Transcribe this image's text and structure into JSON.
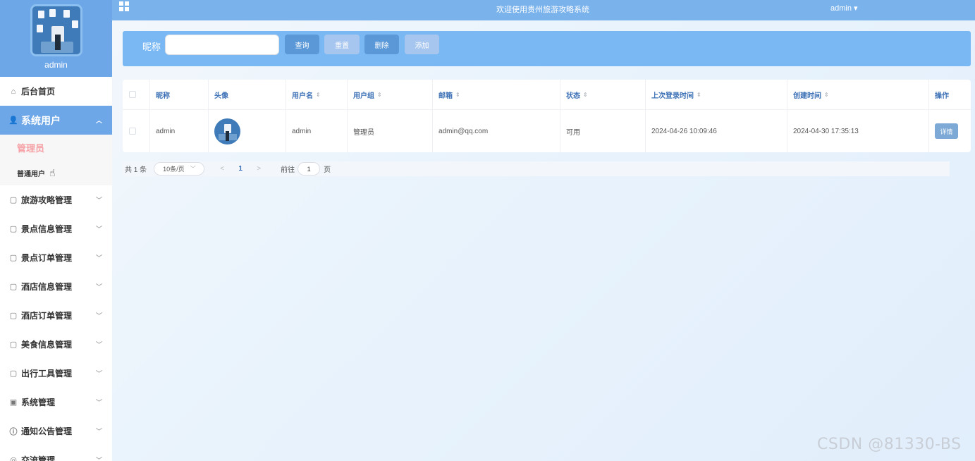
{
  "app": {
    "welcome_title": "欢迎使用贵州旅游攻略系统",
    "user_menu": "admin ▾"
  },
  "sidebar": {
    "username": "admin",
    "items": [
      {
        "label": "后台首页",
        "icon": "home-icon"
      },
      {
        "label": "系统用户",
        "icon": "user-icon",
        "active": true
      },
      {
        "label": "旅游攻略管理",
        "icon": "folder-icon"
      },
      {
        "label": "景点信息管理",
        "icon": "folder-icon"
      },
      {
        "label": "景点订单管理",
        "icon": "folder-icon"
      },
      {
        "label": "酒店信息管理",
        "icon": "folder-icon"
      },
      {
        "label": "酒店订单管理",
        "icon": "folder-icon"
      },
      {
        "label": "美食信息管理",
        "icon": "folder-icon"
      },
      {
        "label": "出行工具管理",
        "icon": "folder-icon"
      },
      {
        "label": "系统管理",
        "icon": "picture-icon"
      },
      {
        "label": "通知公告管理",
        "icon": "info-icon"
      },
      {
        "label": "交流管理",
        "icon": "chat-icon"
      }
    ],
    "submenu": [
      {
        "label": "管理员",
        "current": true
      },
      {
        "label": "普通用户"
      }
    ]
  },
  "search": {
    "label": "昵称",
    "value": "",
    "placeholder": "",
    "buttons": {
      "query": "查询",
      "reset": "重置",
      "delete": "删除",
      "add": "添加"
    }
  },
  "table": {
    "columns": [
      "昵称",
      "头像",
      "用户名",
      "用户组",
      "邮箱",
      "状态",
      "上次登录时间",
      "创建时间",
      "操作"
    ],
    "rows": [
      {
        "nickname": "admin",
        "avatar": "avatar-image",
        "username": "admin",
        "group": "管理员",
        "email": "admin@qq.com",
        "status": "可用",
        "last_login": "2024-04-26 10:09:46",
        "created": "2024-04-30 17:35:13",
        "action": "详情"
      }
    ]
  },
  "pagination": {
    "total": "共 1 条",
    "page_size": "10条/页",
    "prev": "<",
    "current_page": "1",
    "next": ">",
    "goto_label": "前往",
    "goto_value": "1",
    "page_suffix": "页"
  },
  "watermark": "CSDN @81330-BS",
  "colors": {
    "primary": "#6ea7e8",
    "topbar": "#7ab2ec",
    "search_panel": "#7ab8f4",
    "header_text": "#3a6fb5",
    "submenu_current": "#f6a0a6"
  }
}
